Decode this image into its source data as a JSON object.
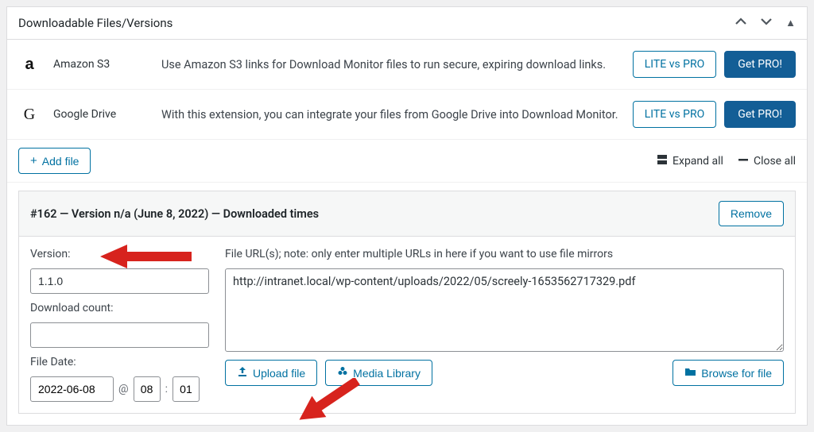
{
  "panel": {
    "title": "Downloadable Files/Versions"
  },
  "integrations": [
    {
      "iconGlyph": "a",
      "iconName": "amazon-s3-icon",
      "name": "Amazon S3",
      "desc": "Use Amazon S3 links for Download Monitor files to run secure, expiring download links.",
      "lite_label": "LITE vs PRO",
      "pro_label": "Get PRO!"
    },
    {
      "iconGlyph": "G",
      "iconName": "google-drive-icon",
      "name": "Google Drive",
      "desc": "With this extension, you can integrate your files from Google Drive into Download Monitor.",
      "lite_label": "LITE vs PRO",
      "pro_label": "Get PRO!"
    }
  ],
  "toolbar": {
    "add_file_label": "Add file",
    "expand_all_label": "Expand all",
    "close_all_label": "Close all"
  },
  "version": {
    "header_title": "#162 — Version n/a (June 8, 2022) — Downloaded times",
    "remove_label": "Remove",
    "version_label": "Version:",
    "version_value": "1.1.0",
    "download_count_label": "Download count:",
    "download_count_value": "",
    "file_date_label": "File Date:",
    "date_value": "2022-06-08",
    "hour_value": "08",
    "minute_value": "01",
    "url_label": "File URL(s); note: only enter multiple URLs in here if you want to use file mirrors",
    "url_value": "http://intranet.local/wp-content/uploads/2022/05/screely-1653562717329.pdf",
    "upload_label": "Upload file",
    "media_label": "Media Library",
    "browse_label": "Browse for file"
  }
}
